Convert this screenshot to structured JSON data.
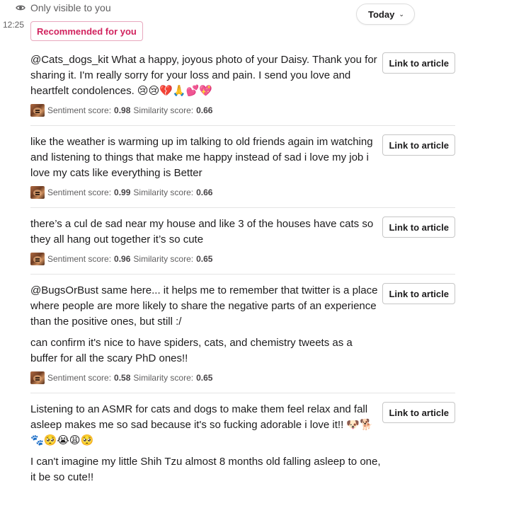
{
  "header": {
    "visibility_text": "Only visible to you",
    "timestamp": "12:25",
    "date_pill": "Today",
    "badge": "Recommended for you"
  },
  "labels": {
    "link_button": "Link to article",
    "sentiment": "Sentiment score:",
    "similarity": "Similarity score:"
  },
  "results": [
    {
      "paragraphs": [
        "@Cats_dogs_kit What a happy, joyous photo of your Daisy. Thank you for sharing it. I'm really sorry for your loss and pain. I send you love and heartfelt condolences. 😢😢💔🙏💕💖"
      ],
      "sentiment": "0.98",
      "similarity": "0.66"
    },
    {
      "paragraphs": [
        "like the weather is warming up im talking to old friends again im watching and listening to things that make me happy instead of sad i love my job i love my cats like everything is Better"
      ],
      "sentiment": "0.99",
      "similarity": "0.66"
    },
    {
      "paragraphs": [
        "there’s a cul de sad near my house and like 3 of the houses have cats so they all hang out together it’s so cute"
      ],
      "sentiment": "0.96",
      "similarity": "0.65"
    },
    {
      "paragraphs": [
        "@BugsOrBust same here... it helps me to remember that twitter is a place where people are more likely to share the negative parts of an experience than the positive ones, but still :/",
        "can confirm it's nice to have spiders, cats, and chemistry tweets as a buffer for all the scary PhD ones!!"
      ],
      "sentiment": "0.58",
      "similarity": "0.65"
    },
    {
      "paragraphs": [
        "Listening to an ASMR for cats and dogs to make them feel relax and fall asleep makes me so sad because it's so fucking adorable i love it!! 🐶🐕🐾🥺😭😩🥺",
        "I can't imagine my little Shih Tzu almost 8 months old falling asleep to one, it be so cute!!"
      ],
      "sentiment": "",
      "similarity": ""
    }
  ],
  "icons": {
    "visibility": "eye-icon",
    "dropdown": "chevron-down-icon",
    "thumbnail": "cat-thumbnail-icon"
  },
  "colors": {
    "badge_text": "#d1235e",
    "badge_border": "#e8a8be",
    "muted_text": "#616061"
  }
}
